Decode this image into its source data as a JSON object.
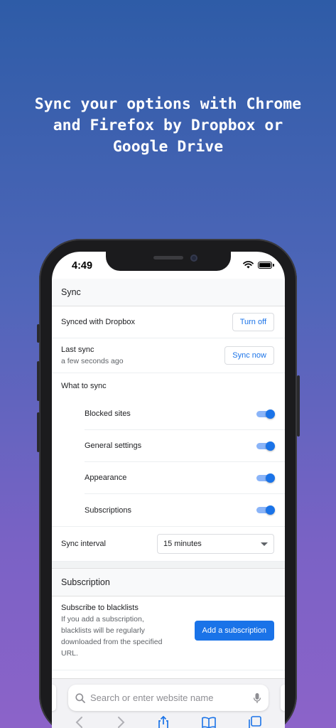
{
  "headline": "Sync your options with Chrome\nand Firefox by Dropbox or\nGoogle Drive",
  "status_bar": {
    "time": "4:49"
  },
  "sync": {
    "title": "Sync",
    "synced_with": "Synced with Dropbox",
    "turn_off_label": "Turn off",
    "last_sync_label": "Last sync",
    "last_sync_value": "a few seconds ago",
    "sync_now_label": "Sync now",
    "what_to_sync_label": "What to sync",
    "items": [
      {
        "label": "Blocked sites",
        "on": true
      },
      {
        "label": "General settings",
        "on": true
      },
      {
        "label": "Appearance",
        "on": true
      },
      {
        "label": "Subscriptions",
        "on": true
      }
    ],
    "interval_label": "Sync interval",
    "interval_value": "15 minutes"
  },
  "subscription": {
    "title": "Subscription",
    "subscribe_title": "Subscribe to blacklists",
    "subscribe_desc": "If you add a subscription, blacklists will be regularly downloaded from the specified URL.",
    "add_button_label": "Add a subscription"
  },
  "browser": {
    "search_placeholder": "Search or enter website name"
  },
  "colors": {
    "accent": "#1a73e8",
    "toggle_track": "#8ab4f8",
    "bg_top": "#2e5ca7",
    "bg_bottom": "#8c63c9"
  },
  "icons": [
    "wifi-icon",
    "battery-icon",
    "search-icon",
    "microphone-icon",
    "back-icon",
    "forward-icon",
    "share-icon",
    "bookmarks-icon",
    "tabs-icon",
    "chevron-down-icon"
  ]
}
